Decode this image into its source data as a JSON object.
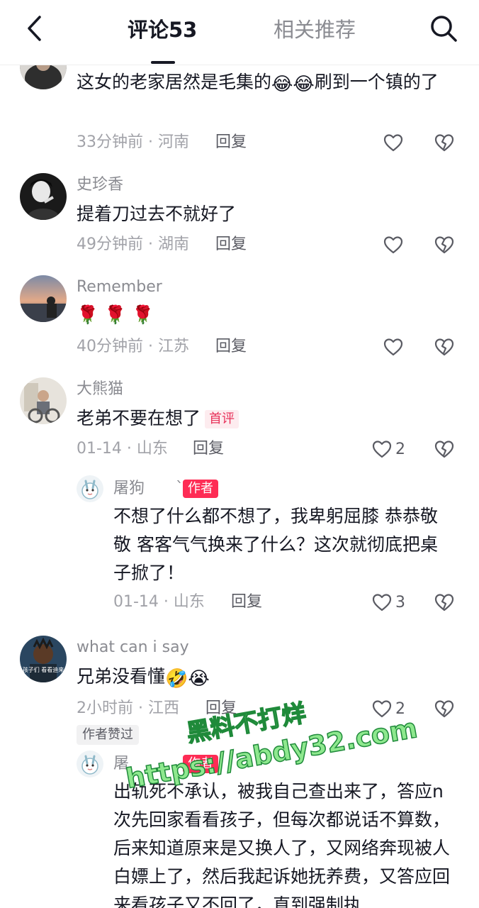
{
  "header": {
    "tab_comments": "评论53",
    "tab_related": "相关推荐"
  },
  "comments": [
    {
      "text_a": "这女的老家居然是毛集的",
      "emoji_a": "😂😂",
      "text_b": "刷到一个镇的了",
      "meta": "33分钟前 · 河南",
      "reply": "回复"
    },
    {
      "user": "史珍香",
      "text": "提着刀过去不就好了",
      "meta": "49分钟前 · 湖南",
      "reply": "回复"
    },
    {
      "user": "Remember",
      "text": "🌹 🌹 🌹",
      "meta": "40分钟前 · 江苏",
      "reply": "回复"
    },
    {
      "user": "大熊猫",
      "text": "老弟不要在想了",
      "badge": "首评",
      "meta": "01-14 · 山东",
      "reply": "回复",
      "likes": "2"
    },
    {
      "user": "屠狗",
      "user_suffix": "`",
      "badge": "作者",
      "text": "不想了什么都不想了，我卑躬屈膝 恭恭敬敬 客客气气换来了什么？这次就彻底把桌子掀了！",
      "meta": "01-14 · 山东",
      "reply": "回复",
      "likes": "3"
    },
    {
      "user": "what can i say",
      "text": "兄弟没看懂",
      "emoji": "🤣😭",
      "meta": "2小时前 · 江西",
      "reply": "回复",
      "likes": "2",
      "liked_badge": "作者赞过",
      "avatar_caption": "孩子们 看看迪来"
    },
    {
      "user": "屠",
      "badge": "作者",
      "text": "出轨死不承认，被我自己查出来了，答应n次先回家看看孩子，但每次都说话不算数，后来知道原来是又换人了，又网络奔现被人白嫖上了，然后我起诉她抚养费，又答应回来看孩子又不回了，直到强制执"
    }
  ],
  "watermark": {
    "line1": "黑料不打烊",
    "line2": "https://abdy32.com"
  },
  "colors": {
    "accent": "#fe2c55",
    "text": "#161823",
    "muted": "#8a8b91"
  }
}
